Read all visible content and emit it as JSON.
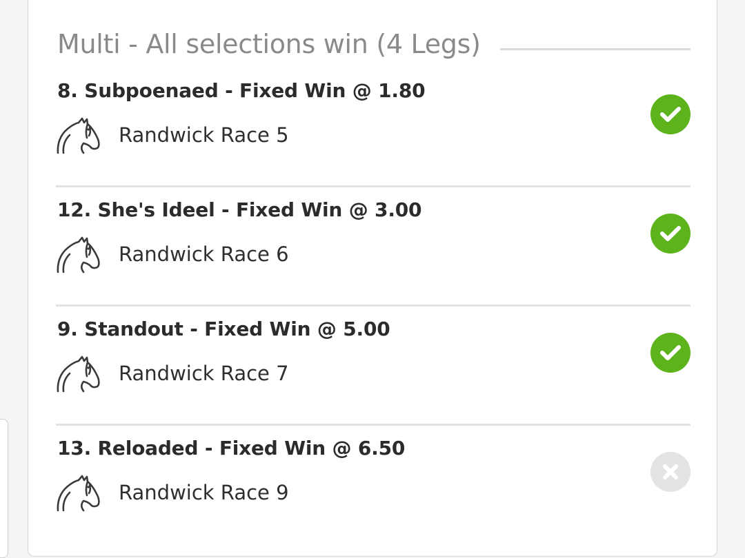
{
  "header": {
    "title": "Multi - All selections win (4 Legs)"
  },
  "legs": [
    {
      "title": "8. Subpoenaed - Fixed Win @ 1.80",
      "race": "Randwick Race 5",
      "icon": "horse-icon",
      "status": "won",
      "status_icon": "check-circle-icon"
    },
    {
      "title": "12. She's Ideel - Fixed Win @ 3.00",
      "race": "Randwick Race 6",
      "icon": "horse-icon",
      "status": "won",
      "status_icon": "check-circle-icon"
    },
    {
      "title": "9. Standout - Fixed Win @ 5.00",
      "race": "Randwick Race 7",
      "icon": "horse-icon",
      "status": "won",
      "status_icon": "check-circle-icon"
    },
    {
      "title": "13. Reloaded - Fixed Win @ 6.50",
      "race": "Randwick Race 9",
      "icon": "horse-icon",
      "status": "lost",
      "status_icon": "x-circle-icon"
    }
  ],
  "colors": {
    "won": "#5cb31b",
    "lost": "#e3e3e3",
    "title_gray": "#8a8a8a"
  }
}
